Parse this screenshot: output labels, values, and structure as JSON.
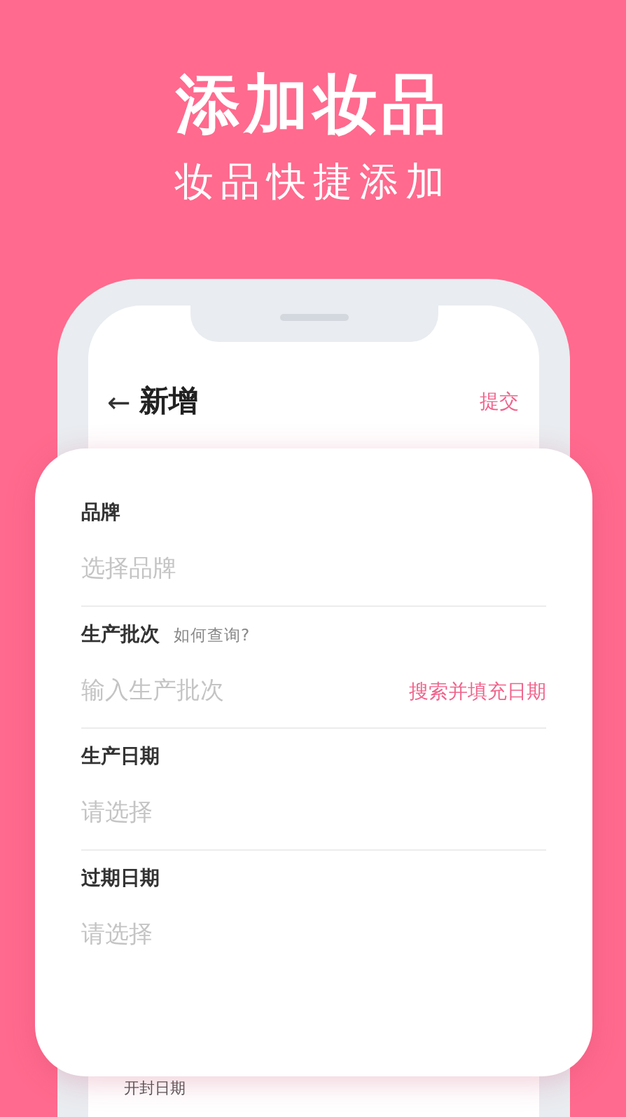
{
  "headline": "添加妆品",
  "subheadline": "妆品快捷添加",
  "screen": {
    "back_icon": "←",
    "title": "新增",
    "submit": "提交",
    "below_card_label": "开封日期"
  },
  "fields": [
    {
      "label": "品牌",
      "placeholder": "选择品牌"
    },
    {
      "label": "生产批次",
      "hint": "如何查询?",
      "placeholder": "输入生产批次",
      "action": "搜索并填充日期"
    },
    {
      "label": "生产日期",
      "placeholder": "请选择"
    },
    {
      "label": "过期日期",
      "placeholder": "请选择"
    }
  ]
}
